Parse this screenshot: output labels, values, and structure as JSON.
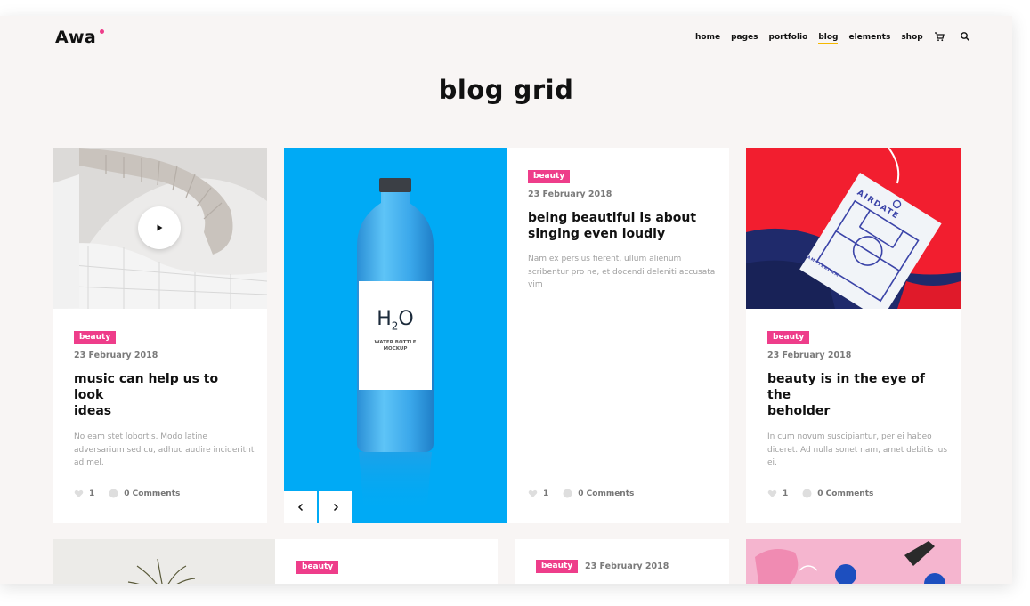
{
  "header": {
    "logo": "Awa",
    "nav": [
      "home",
      "pages",
      "portfolio",
      "blog",
      "elements",
      "shop"
    ],
    "active_nav": "blog"
  },
  "page_title": "blog grid",
  "posts": [
    {
      "category": "beauty",
      "date": "23 February 2018",
      "title_line1": "music can help us to look",
      "title_line2": "ideas",
      "excerpt_line1": "No eam stet lobortis. Modo latine",
      "excerpt_line2": "adversarium sed cu, adhuc audire incideritnt",
      "excerpt_line3": "ad mel.",
      "likes": "1",
      "comments": "0 Comments"
    },
    {
      "bottle_label": "H2O",
      "bottle_sub1": "WATER BOTTLE",
      "bottle_sub2": "MOCKUP",
      "category": "beauty",
      "date": "23 February 2018",
      "title_line1": "being beautiful is about",
      "title_line2": "singing even loudly",
      "excerpt_line1": "Nam ex persius fierent, ullum alienum",
      "excerpt_line2": "scribentur pro ne, et docendi deleniti accusata",
      "excerpt_line3": "vim",
      "likes": "1",
      "comments": "0 Comments"
    },
    {
      "tag_text": "AIRDATE",
      "tag_sub": "AMSTERDAM",
      "category": "beauty",
      "date": "23 February 2018",
      "title_line1": "beauty is in the eye of the",
      "title_line2": "beholder",
      "excerpt_line1": "In cum novum suscipiantur, per ei habeo",
      "excerpt_line2": "diceret. Ad nulla sonet nam, amet debitis ius",
      "excerpt_line3": "ei.",
      "likes": "1",
      "comments": "0 Comments"
    }
  ],
  "row2": [
    {
      "category": "beauty"
    },
    {
      "category": "beauty",
      "date": "23 February 2018"
    }
  ],
  "colors": {
    "accent_pink": "#ee3d8a",
    "nav_underline": "#f5b800",
    "bottle_bg": "#00aaf5",
    "tag_red": "#f21e2f"
  },
  "icons": [
    "cart-icon",
    "search-icon",
    "play-icon",
    "heart-icon",
    "comment-icon",
    "chevron-left-icon",
    "chevron-right-icon"
  ]
}
